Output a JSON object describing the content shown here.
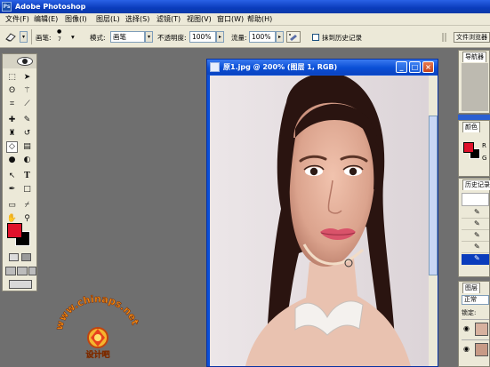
{
  "app": {
    "title": "Adobe Photoshop",
    "logo": "Ps"
  },
  "menu": [
    {
      "label": "文件(F)"
    },
    {
      "label": "编辑(E)"
    },
    {
      "label": "图像(I)"
    },
    {
      "label": "图层(L)"
    },
    {
      "label": "选择(S)"
    },
    {
      "label": "滤镜(T)"
    },
    {
      "label": "视图(V)"
    },
    {
      "label": "窗口(W)"
    },
    {
      "label": "帮助(H)"
    }
  ],
  "options": {
    "brush_label": "画笔:",
    "brush_size": "7",
    "mode_label": "模式:",
    "mode_value": "画笔",
    "opacity_label": "不透明度:",
    "opacity_value": "100%",
    "flow_label": "流量:",
    "flow_value": "100%",
    "erase_history_label": "抹到历史记录",
    "palette_button": "文件浏览器"
  },
  "document": {
    "title": "原1.jpg @ 200% (图层 1, RGB)"
  },
  "watermark": {
    "text": "www.chinaps.net",
    "subtitle": "设计吧"
  },
  "panels": {
    "navigator_tab": "导航器",
    "color_tab": "颜色",
    "color_channel_r": "R",
    "color_channel_g": "G",
    "history_tab": "历史记录",
    "layers_tab": "图层",
    "blend_mode": "正常",
    "lock_label": "锁定:"
  },
  "colors": {
    "foreground": "#e0112b",
    "background": "#000000",
    "titlebar": "#0a3cbc",
    "panel_bg": "#ece9d8"
  },
  "icons": {
    "toolbox_header": "eye-icon",
    "tools": [
      "marquee-icon",
      "move-icon",
      "lasso-icon",
      "magic-wand-icon",
      "crop-icon",
      "slice-icon",
      "healing-brush-icon",
      "brush-icon",
      "clone-stamp-icon",
      "history-brush-icon",
      "eraser-icon",
      "gradient-icon",
      "blur-icon",
      "dodge-icon",
      "path-select-icon",
      "type-icon",
      "pen-icon",
      "shape-icon",
      "notes-icon",
      "eyedropper-icon",
      "hand-icon",
      "zoom-icon"
    ]
  }
}
